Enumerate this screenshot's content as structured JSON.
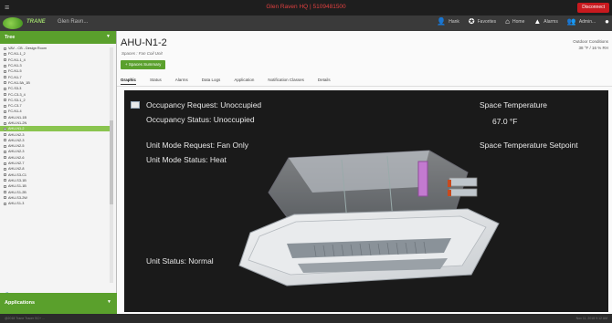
{
  "topbar": {
    "site_title": "Glen Raven HQ | 5109481500",
    "disconnect_label": "Disconnect"
  },
  "navbar": {
    "brand": "TRANE",
    "site_short": "Glen Ravn...",
    "items": [
      {
        "icon": "user-icon",
        "label": "Hank"
      },
      {
        "icon": "favorites-icon",
        "label": "Favorites"
      },
      {
        "icon": "home-icon",
        "label": "Home"
      },
      {
        "icon": "alarms-icon",
        "label": "Alarms"
      },
      {
        "icon": "admin-icon",
        "label": "Admin..."
      }
    ]
  },
  "sidebar": {
    "header": "Tree",
    "apps_label": "Applications",
    "items": [
      "VAV - CB - Design Room",
      "FC-N1-1_2",
      "FC-N1-1_4",
      "FC-N1-3",
      "FC-N1-5",
      "FC-N1-7",
      "FC-N1-5A_1B",
      "FC-S3-3",
      "FC-C3-3_4",
      "FC-S3-1_2",
      "FC-C3-7",
      "FC-N1-4",
      "AHU-N1-1B",
      "AHU-N1-2N",
      "AHU-N1-2",
      "AHU-N2-3",
      "AHU-N2-3",
      "AHU-N2-5",
      "AHU-N2-3",
      "AHU-N2-6",
      "AHU-N2-7",
      "AHU-N2-8",
      "AHU-S3-C1",
      "AHU-S3-1B",
      "AHU-S1-1B",
      "AHU-S1-2B",
      "AHU-S3-2W",
      "AHU-S1-3"
    ],
    "selected_index": 14
  },
  "main": {
    "title": "AHU-N1-2",
    "breadcrumb": "Spaces : Fan Coil Unit",
    "summary_button": "+ Spaces Summary",
    "conditions_label": "Outdoor Conditions",
    "conditions_value": "38 °F / 16 % RH",
    "tabs": [
      "Graphic",
      "Status",
      "Alarms",
      "Data Logs",
      "Application",
      "Notification Classes",
      "Details"
    ],
    "active_tab": 0
  },
  "graphic": {
    "occupancy_request": "Occupancy Request:  Unoccupied",
    "occupancy_status": "Occupancy Status:  Unoccupied",
    "unit_mode_request": "Unit Mode Request:  Fan Only",
    "unit_mode_status": "Unit Mode Status:  Heat",
    "unit_status": "Unit Status:  Normal",
    "space_temp_label": "Space Temperature",
    "space_temp_value": "67.0 °F",
    "space_temp_setpoint_label": "Space Temperature Setpoint"
  },
  "footer": {
    "left": "@2018 Trane Tracer SC+ ...",
    "right": "Nov 11, 2018 9:12 AM"
  },
  "colors": {
    "accent": "#5aa02c",
    "alarm": "#c8191e",
    "panel_bg": "#1a1a1a"
  }
}
